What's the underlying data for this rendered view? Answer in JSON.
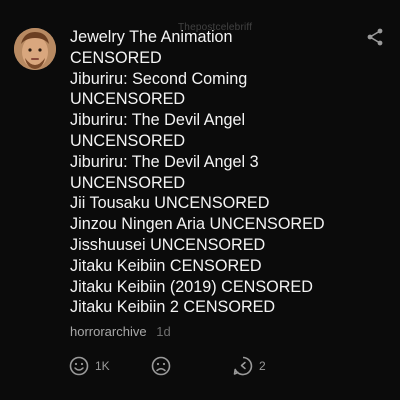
{
  "comment": {
    "author": "horrorarchive",
    "time": "1d",
    "watermark": "Thepostcelebriff",
    "lines": [
      "Jewelry The Animation",
      "CENSORED",
      "Jiburiru: Second Coming",
      "UNCENSORED",
      "Jiburiru: The Devil Angel",
      "UNCENSORED",
      "Jiburiru: The Devil Angel 3",
      "UNCENSORED",
      "Jii Tousaku UNCENSORED",
      "Jinzou Ningen Aria UNCENSORED",
      "Jisshuusei UNCENSORED",
      "Jitaku Keibiin CENSORED",
      "Jitaku Keibiin (2019) CENSORED",
      "Jitaku Keibiin 2 CENSORED"
    ]
  },
  "actions": {
    "like_count": "1K",
    "reply_count": "2"
  },
  "icons": {
    "share": "share-icon",
    "like": "smile-icon",
    "dislike": "frown-icon",
    "reply": "reply-icon"
  },
  "colors": {
    "background": "#0b0b0b",
    "text": "#f4f4f4",
    "muted": "#a8a8a8"
  }
}
